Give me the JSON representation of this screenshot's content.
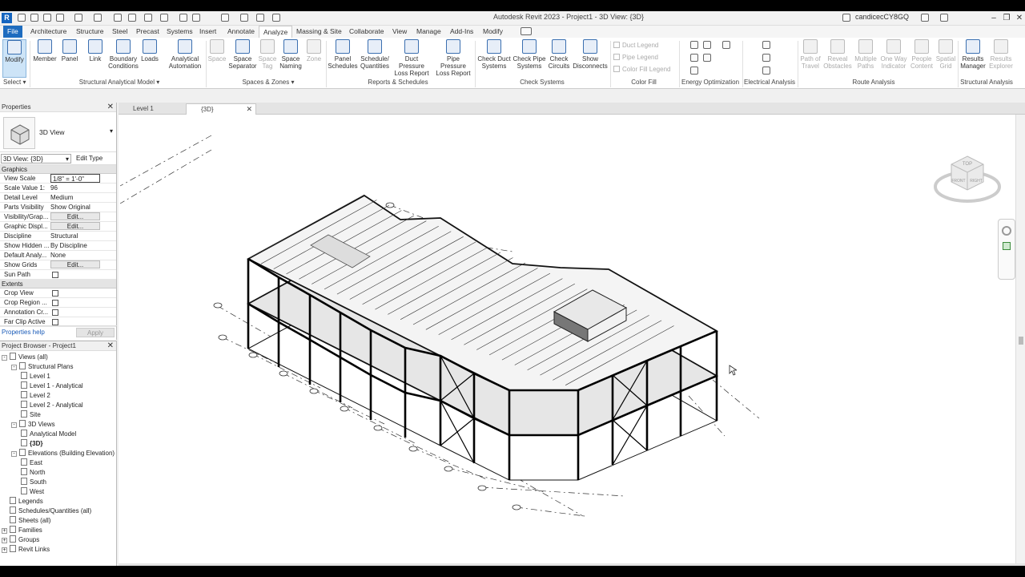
{
  "window": {
    "title": "Autodesk Revit 2023 - Project1 - 3D View: {3D}",
    "user": "candicecCY8GQ",
    "logo": "R"
  },
  "menu": {
    "tabs": [
      "File",
      "Architecture",
      "Structure",
      "Steel",
      "Precast",
      "Systems",
      "Insert",
      "Annotate",
      "Analyze",
      "Massing & Site",
      "Collaborate",
      "View",
      "Manage",
      "Add-Ins",
      "Modify"
    ],
    "active": "Analyze"
  },
  "ribbon": {
    "select": {
      "modify": "Modify",
      "select": "Select"
    },
    "structural": {
      "member": "Member",
      "panel": "Panel",
      "link": "Link",
      "boundary": "Boundary Conditions",
      "loads": "Loads",
      "automation": "Analytical Automation",
      "group": "Structural Analytical Model"
    },
    "spaces": {
      "space": "Space",
      "separator": "Space Separator",
      "tag": "Space Tag",
      "naming": "Space Naming",
      "zone": "Zone",
      "group": "Spaces & Zones"
    },
    "reports": {
      "panel_schedules": "Panel Schedules",
      "schedules": "Schedule/ Quantities",
      "duct_pressure": "Duct Pressure Loss Report",
      "pipe_pressure": "Pipe Pressure Loss Report",
      "group": "Reports & Schedules"
    },
    "check": {
      "duct": "Check Duct Systems",
      "pipe": "Check Pipe Systems",
      "circuits": "Check Circuits",
      "disconnects": "Show Disconnects",
      "group": "Check Systems"
    },
    "colorfill": {
      "duct_legend": "Duct Legend",
      "pipe_legend": "Pipe Legend",
      "color_fill_legend": "Color Fill Legend",
      "group": "Color Fill"
    },
    "energy": {
      "group": "Energy Optimization"
    },
    "electrical": {
      "group": "Electrical Analysis"
    },
    "route": {
      "path": "Path of Travel",
      "reveal": "Reveal Obstacles",
      "multiple": "Multiple Paths",
      "oneway": "One Way Indicator",
      "people": "People Content",
      "spatial": "Spatial Grid",
      "group": "Route Analysis"
    },
    "results": {
      "manager": "Results Manager",
      "explorer": "Results Explorer",
      "group": "Structural Analysis"
    }
  },
  "properties": {
    "title": "Properties",
    "type_name": "3D View",
    "selector": "3D View: {3D}",
    "edit_type": "Edit Type",
    "section_graphics": "Graphics",
    "rows": [
      {
        "key": "View Scale",
        "value": "1/8\" = 1'-0\""
      },
      {
        "key": "Scale Value    1:",
        "value": "96"
      },
      {
        "key": "Detail Level",
        "value": "Medium"
      },
      {
        "key": "Parts Visibility",
        "value": "Show Original"
      },
      {
        "key": "Visibility/Grap...",
        "value": "Edit..."
      },
      {
        "key": "Graphic Displ...",
        "value": "Edit..."
      },
      {
        "key": "Discipline",
        "value": "Structural"
      },
      {
        "key": "Show Hidden ...",
        "value": "By Discipline"
      },
      {
        "key": "Default Analy...",
        "value": "None"
      },
      {
        "key": "Show Grids",
        "value": "Edit..."
      },
      {
        "key": "Sun Path",
        "value": ""
      }
    ],
    "section_extents": "Extents",
    "extents_rows": [
      {
        "key": "Crop View"
      },
      {
        "key": "Crop Region ..."
      },
      {
        "key": "Annotation Cr..."
      },
      {
        "key": "Far Clip Active"
      }
    ],
    "help": "Properties help",
    "apply": "Apply"
  },
  "browser": {
    "title": "Project Browser - Project1",
    "items": [
      "Views (all)",
      "Structural Plans",
      "Level 1",
      "Level 1 - Analytical",
      "Level 2",
      "Level 2 - Analytical",
      "Site",
      "3D Views",
      "Analytical Model",
      "{3D}",
      "Elevations (Building Elevation)",
      "East",
      "North",
      "South",
      "West",
      "Legends",
      "Schedules/Quantities (all)",
      "Sheets (all)",
      "Families",
      "Groups",
      "Revit Links"
    ]
  },
  "view_tabs": [
    "Level 1",
    "{3D}"
  ],
  "viewcube": {
    "top": "TOP",
    "front": "FRONT",
    "right": "RIGHT"
  }
}
